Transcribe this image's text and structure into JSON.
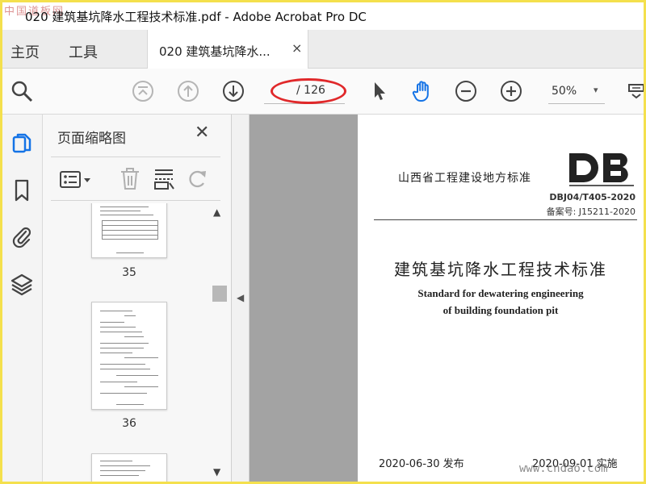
{
  "window": {
    "title": "020 建筑基坑降水工程技术标准.pdf - Adobe Acrobat Pro DC",
    "watermark_logo": "中国道板网"
  },
  "tabs": {
    "home": "主页",
    "tools": "工具",
    "document": "020 建筑基坑降水...",
    "close_symbol": "×"
  },
  "toolbar": {
    "search_icon": "zoom-search-icon",
    "page_total": "/ 126",
    "page_current": "",
    "zoom_value": "50%",
    "zoom_caret": "▾",
    "icons": [
      "zoom-search-icon",
      "first-page-icon",
      "prev-page-icon",
      "next-page-icon",
      "select-cursor-icon",
      "hand-tool-icon",
      "zoom-out-icon",
      "zoom-in-icon",
      "more-tools-icon"
    ],
    "highlight_color": "#e0282a"
  },
  "rail": {
    "icons": [
      "page-thumbnails-icon",
      "bookmark-icon",
      "attachment-icon",
      "layers-icon"
    ],
    "active_color": "#1473e6"
  },
  "thumbnails_panel": {
    "title": "页面缩略图",
    "close_symbol": "✕",
    "tool_icons": [
      "options-menu-icon",
      "delete-icon",
      "page-layout-icon",
      "rotate-icon"
    ],
    "pages": [
      {
        "number": "35"
      },
      {
        "number": "36"
      }
    ],
    "scrollbar": {
      "up": "▲",
      "down": "▼"
    }
  },
  "splitter": {
    "arrow": "◀"
  },
  "document_page": {
    "header": "山西省工程建设地方标准",
    "logo_text": "DB",
    "code": "DBJ04/T405-2020",
    "record": "备案号: J15211-2020",
    "title_cn": "建筑基坑降水工程技术标准",
    "title_en_line1": "Standard for dewatering engineering",
    "title_en_line2": "of building foundation pit",
    "issue_date": "2020-06-30 发布",
    "implement_date": "2020-09-01 实施"
  },
  "site_watermark": "www.cndao.com",
  "colors": {
    "outer_border": "#f4e04d",
    "doc_bg": "#a3a3a3",
    "accent_blue": "#1473e6"
  }
}
